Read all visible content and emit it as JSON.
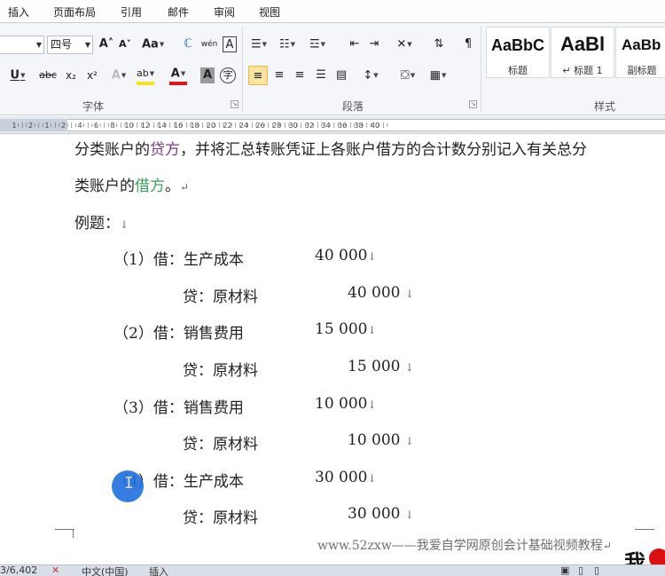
{
  "tabs": [
    "插入",
    "页面布局",
    "引用",
    "邮件",
    "审阅",
    "视图"
  ],
  "ribbon": {
    "font_name": "",
    "font_size": "四号",
    "groups": {
      "font": "字体",
      "paragraph": "段落",
      "styles": "样式"
    },
    "font_buttons": {
      "grow": "A˄",
      "shrink": "A˅",
      "case": "Aa",
      "clear": "ℂ",
      "pinyin": "wén",
      "border_char": "A",
      "underline": "U",
      "strike": "abc",
      "sub": "x₂",
      "sup": "x²",
      "effects": "A",
      "highlight": "ab",
      "color": "A",
      "shading": "A",
      "enclose": "字"
    },
    "styles": [
      {
        "preview": "AaBbC",
        "name": "标题"
      },
      {
        "preview": "AaBl",
        "name": "↵ 标题 1"
      },
      {
        "preview": "AaBb",
        "name": "副标题"
      }
    ]
  },
  "document": {
    "line1": {
      "a": "分类账户的",
      "b": "贷方",
      "c": "，并将汇总转账凭证上各账户借方的合计数分别记入有关总分"
    },
    "line2": {
      "a": "类账户的",
      "b": "借方",
      "c": "。"
    },
    "example_label": "例题：",
    "entries": [
      {
        "num": "（1）",
        "debit_label": "借：",
        "debit_account": "生产成本",
        "debit_amount": "40 000",
        "credit_label": "贷：",
        "credit_account": "原材料",
        "credit_amount": "40 000"
      },
      {
        "num": "（2）",
        "debit_label": "借：",
        "debit_account": "销售费用",
        "debit_amount": "15 000",
        "credit_label": "贷：",
        "credit_account": "原材料",
        "credit_amount": "15 000"
      },
      {
        "num": "（3）",
        "debit_label": "借：",
        "debit_account": "销售费用",
        "debit_amount": "10 000",
        "credit_label": "贷：",
        "credit_account": "原材料",
        "credit_amount": "10 000"
      },
      {
        "num": "（4）",
        "debit_label": "借：",
        "debit_account": "生产成本",
        "debit_amount": "30 000",
        "credit_label": "贷：",
        "credit_account": "原材料",
        "credit_amount": "30 000"
      }
    ],
    "watermark": "www.52zxw——我爱自学网原创会计基础视频教程"
  },
  "logo_text": "我",
  "status": {
    "page": "3/6,402",
    "lang": "中文(中国)",
    "mode": "插入"
  },
  "ruler_labels": [
    "1",
    "2",
    "1",
    "2",
    "4",
    "6",
    "8",
    "10",
    "12",
    "14",
    "16",
    "18",
    "20",
    "22",
    "24",
    "26",
    "28",
    "30",
    "32",
    "34",
    "36",
    "38",
    "40"
  ],
  "colors": {
    "purple": "#7a3c8f",
    "green": "#3aa15b",
    "cursor": "#1f6fe0"
  }
}
